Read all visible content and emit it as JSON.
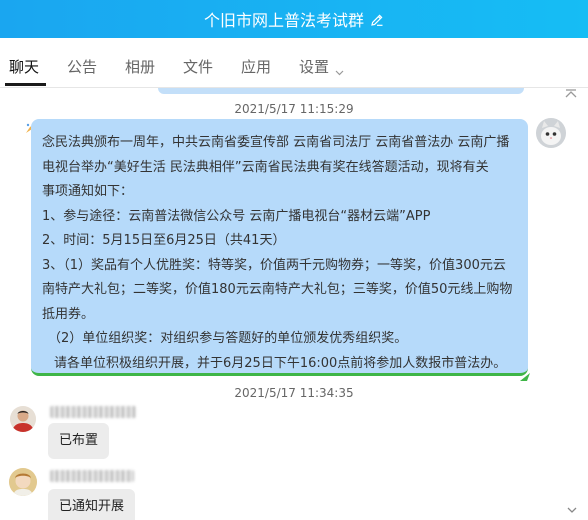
{
  "window": {
    "title": "个旧市网上普法考试群",
    "edit_icon": "pencil-edit-icon"
  },
  "tabs": [
    {
      "label": "聊天",
      "active": true
    },
    {
      "label": "公告",
      "active": false
    },
    {
      "label": "相册",
      "active": false
    },
    {
      "label": "文件",
      "active": false
    },
    {
      "label": "应用",
      "active": false
    },
    {
      "label": "设置",
      "active": false,
      "dropdown": true
    }
  ],
  "colors": {
    "titlebar": "#1aa6f0",
    "own_bubble": "#b6dafa",
    "bubble_accent": "#3fb547",
    "other_bubble": "#ececec"
  },
  "messages": {
    "timestamp_1": "2021/5/17 11:15:29",
    "notice_lines": [
      "念民法典颁布一周年，中共云南省委宣传部 云南省司法厅   云南省普法办 云南广播",
      "电视台举办“美好生活  民法典相伴”云南省民法典有奖在线答题活动，现将有关",
      "事项通知如下：",
      "1、参与途径：云南普法微信公众号    云南广播电视台“器材云端”APP",
      "2、时间：5月15日至6月25日（共41天）",
      "3、（1）奖品有个人优胜奖：特等奖，价值两千元购物券；一等奖，价值300元云",
      "南特产大礼包；二等奖，价值180元云南特产大礼包；三等奖，价值50元线上购物",
      "抵用券。",
      "（2）单位组织奖：对组织参与答题好的单位颁发优秀组织奖。",
      "请各单位积极组织开展，并于6月25日下午16:00点前将参加人数报市普法办。"
    ],
    "timestamp_2": "2021/5/17 11:34:35",
    "reply_1": "已布置",
    "reply_2": "已通知开展"
  }
}
